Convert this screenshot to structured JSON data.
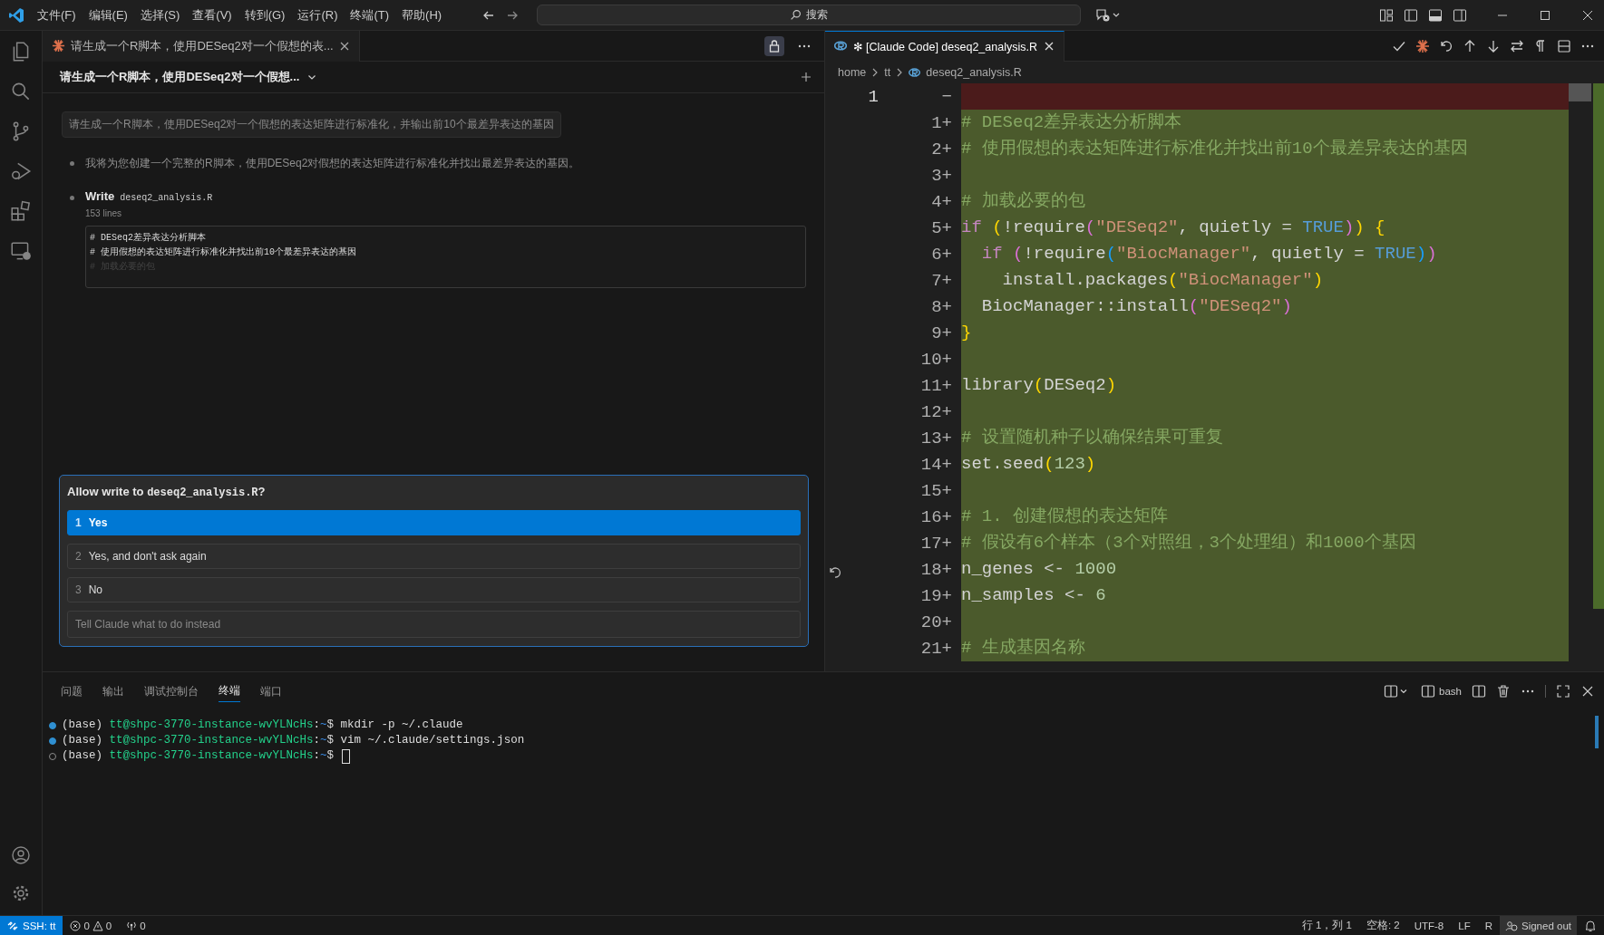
{
  "menu": [
    "文件(F)",
    "编辑(E)",
    "选择(S)",
    "查看(V)",
    "转到(G)",
    "运行(R)",
    "终端(T)",
    "帮助(H)"
  ],
  "search": {
    "placeholder": "搜索"
  },
  "chat": {
    "tab": "请生成一个R脚本，使用DESeq2对一个假想的表...",
    "header": "请生成一个R脚本，使用DESeq2对一个假想...",
    "user_message": "请生成一个R脚本，使用DESeq2对一个假想的表达矩阵进行标准化，并输出前10个最差异表达的基因",
    "assistant_message": "我将为您创建一个完整的R脚本，使用DESeq2对假想的表达矩阵进行标准化并找出最差异表达的基因。",
    "tool": {
      "action": "Write",
      "file": "deseq2_analysis.R",
      "summary": "153 lines",
      "preview": [
        "# DESeq2差异表达分析脚本",
        "# 使用假想的表达矩阵进行标准化并找出前10个最差异表达的基因",
        "# 加载必要的包"
      ]
    },
    "dialog": {
      "title": "Allow write to",
      "file": "deseq2_analysis.R",
      "suffix": "?",
      "options": [
        {
          "number": "1",
          "label": "Yes",
          "selected": true
        },
        {
          "number": "2",
          "label": "Yes, and don't ask again",
          "selected": false
        },
        {
          "number": "3",
          "label": "No",
          "selected": false
        }
      ],
      "input": {
        "placeholder": "Tell Claude what to do instead"
      }
    }
  },
  "editor": {
    "tab": {
      "marker": "✻",
      "title": "[Claude Code] deseq2_analysis.R"
    },
    "breadcrumbs": [
      "home",
      "tt",
      "deseq2_analysis.R"
    ],
    "lines": [
      {
        "kind": "deleted",
        "old_number": "1",
        "marker": "−"
      },
      {
        "kind": "added",
        "new_number": "1",
        "marker": "+",
        "tokens": [
          {
            "kind": "comment",
            "text": "# DESeq2差异表达分析脚本"
          }
        ]
      },
      {
        "kind": "added",
        "new_number": "2",
        "marker": "+",
        "tokens": [
          {
            "kind": "comment",
            "text": "# 使用假想的表达矩阵进行标准化并找出前10个最差异表达的基因"
          }
        ]
      },
      {
        "kind": "added",
        "new_number": "3",
        "marker": "+"
      },
      {
        "kind": "added",
        "new_number": "4",
        "marker": "+",
        "tokens": [
          {
            "kind": "comment",
            "text": "# 加载必要的包"
          }
        ]
      },
      {
        "kind": "added",
        "new_number": "5",
        "marker": "+",
        "tokens": [
          {
            "kind": "keyword",
            "text": "if "
          },
          {
            "kind": "paren1",
            "text": "("
          },
          {
            "kind": "plain",
            "text": "!require"
          },
          {
            "kind": "paren2",
            "text": "("
          },
          {
            "kind": "string",
            "text": "\"DESeq2\""
          },
          {
            "kind": "plain",
            "text": ", quietly = "
          },
          {
            "kind": "const",
            "text": "TRUE"
          },
          {
            "kind": "paren2",
            "text": ")"
          },
          {
            "kind": "paren1",
            "text": ") {"
          }
        ]
      },
      {
        "kind": "added",
        "new_number": "6",
        "marker": "+",
        "tokens": [
          {
            "kind": "keyword",
            "text": "  if "
          },
          {
            "kind": "paren2",
            "text": "("
          },
          {
            "kind": "plain",
            "text": "!require"
          },
          {
            "kind": "paren3",
            "text": "("
          },
          {
            "kind": "string",
            "text": "\"BiocManager\""
          },
          {
            "kind": "plain",
            "text": ", quietly = "
          },
          {
            "kind": "const",
            "text": "TRUE"
          },
          {
            "kind": "paren3",
            "text": ")"
          },
          {
            "kind": "paren2",
            "text": ")"
          }
        ]
      },
      {
        "kind": "added",
        "new_number": "7",
        "marker": "+",
        "tokens": [
          {
            "kind": "plain",
            "text": "    install.packages"
          },
          {
            "kind": "paren1",
            "text": "("
          },
          {
            "kind": "string",
            "text": "\"BiocManager\""
          },
          {
            "kind": "paren1",
            "text": ")"
          }
        ]
      },
      {
        "kind": "added",
        "new_number": "8",
        "marker": "+",
        "tokens": [
          {
            "kind": "plain",
            "text": "  BiocManager::install"
          },
          {
            "kind": "paren2",
            "text": "("
          },
          {
            "kind": "string",
            "text": "\"DESeq2\""
          },
          {
            "kind": "paren2",
            "text": ")"
          }
        ]
      },
      {
        "kind": "added",
        "new_number": "9",
        "marker": "+",
        "tokens": [
          {
            "kind": "paren1",
            "text": "}"
          }
        ]
      },
      {
        "kind": "added",
        "new_number": "10",
        "marker": "+"
      },
      {
        "kind": "added",
        "new_number": "11",
        "marker": "+",
        "tokens": [
          {
            "kind": "plain",
            "text": "library"
          },
          {
            "kind": "paren1",
            "text": "("
          },
          {
            "kind": "plain",
            "text": "DESeq2"
          },
          {
            "kind": "paren1",
            "text": ")"
          }
        ]
      },
      {
        "kind": "added",
        "new_number": "12",
        "marker": "+"
      },
      {
        "kind": "added",
        "new_number": "13",
        "marker": "+",
        "tokens": [
          {
            "kind": "comment",
            "text": "# 设置随机种子以确保结果可重复"
          }
        ]
      },
      {
        "kind": "added",
        "new_number": "14",
        "marker": "+",
        "tokens": [
          {
            "kind": "plain",
            "text": "set.seed"
          },
          {
            "kind": "paren1",
            "text": "("
          },
          {
            "kind": "number",
            "text": "123"
          },
          {
            "kind": "paren1",
            "text": ")"
          }
        ]
      },
      {
        "kind": "added",
        "new_number": "15",
        "marker": "+"
      },
      {
        "kind": "added",
        "new_number": "16",
        "marker": "+",
        "tokens": [
          {
            "kind": "comment",
            "text": "# 1. 创建假想的表达矩阵"
          }
        ]
      },
      {
        "kind": "added",
        "new_number": "17",
        "marker": "+",
        "tokens": [
          {
            "kind": "comment",
            "text": "# 假设有6个样本（3个对照组，3个处理组）和1000个基因"
          }
        ]
      },
      {
        "kind": "added",
        "new_number": "18",
        "marker": "+",
        "tokens": [
          {
            "kind": "plain",
            "text": "n_genes <- "
          },
          {
            "kind": "number",
            "text": "1000"
          }
        ]
      },
      {
        "kind": "added",
        "new_number": "19",
        "marker": "+",
        "tokens": [
          {
            "kind": "plain",
            "text": "n_samples <- "
          },
          {
            "kind": "number",
            "text": "6"
          }
        ]
      },
      {
        "kind": "added",
        "new_number": "20",
        "marker": "+"
      },
      {
        "kind": "added",
        "new_number": "21",
        "marker": "+",
        "tokens": [
          {
            "kind": "comment",
            "text": "# 生成基因名称"
          }
        ]
      }
    ]
  },
  "panel": {
    "tabs": [
      {
        "label": "问题",
        "selected": false
      },
      {
        "label": "输出",
        "selected": false
      },
      {
        "label": "调试控制台",
        "selected": false
      },
      {
        "label": "终端",
        "selected": true
      },
      {
        "label": "端口",
        "selected": false
      }
    ],
    "shell": "bash",
    "terminal": [
      {
        "succeeded": true,
        "env": "(base)",
        "user": "tt@shpc-3770-instance-wvYLNcHs",
        "separator": ":",
        "path": "~",
        "prompt": "$",
        "command": "mkdir -p ~/.claude"
      },
      {
        "succeeded": true,
        "env": "(base)",
        "user": "tt@shpc-3770-instance-wvYLNcHs",
        "separator": ":",
        "path": "~",
        "prompt": "$",
        "command": "vim ~/.claude/settings.json"
      },
      {
        "succeeded": false,
        "env": "(base)",
        "user": "tt@shpc-3770-instance-wvYLNcHs",
        "separator": ":",
        "path": "~",
        "prompt": "$",
        "cursor": true
      }
    ]
  },
  "status_bar": {
    "remote": "SSH: tt",
    "errors": "0",
    "warnings": "0",
    "ports": "0",
    "position": "行 1，列 1",
    "indent": "空格: 2",
    "encoding": "UTF-8",
    "eol": "LF",
    "language": "R",
    "account": "Signed out"
  }
}
